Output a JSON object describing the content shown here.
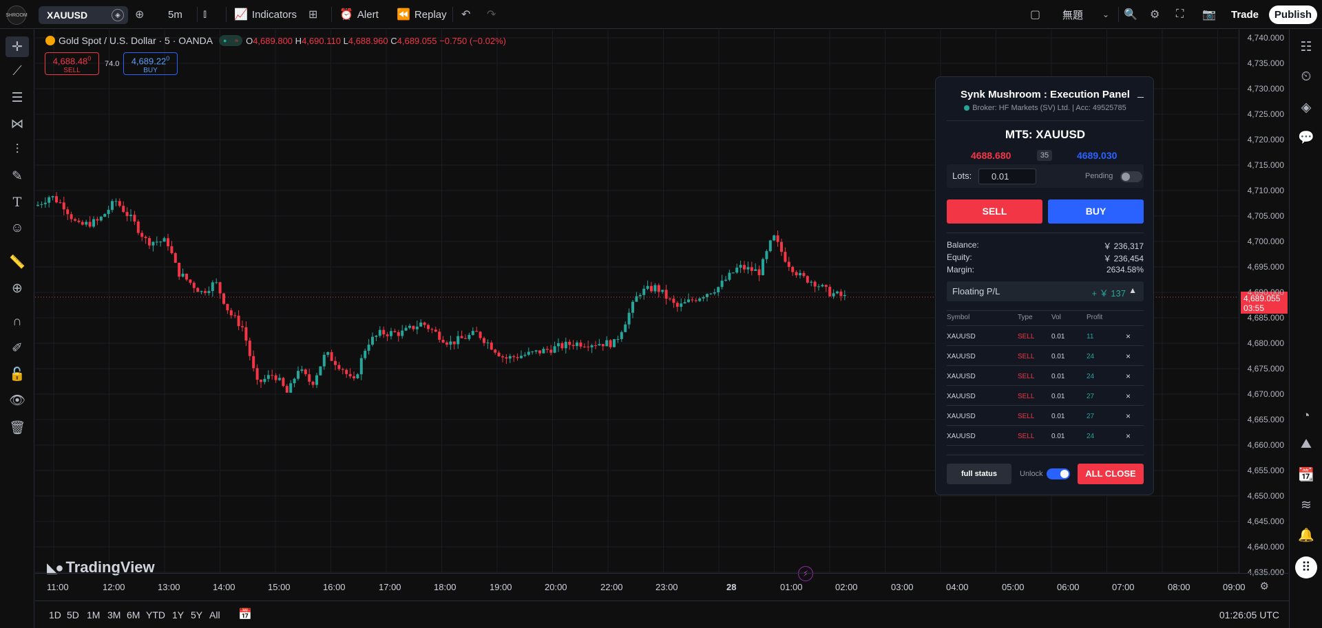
{
  "topbar": {
    "logo_text": "SHROOM",
    "symbol": "XAUUSD",
    "interval": "5m",
    "indicators_label": "Indicators",
    "alert_label": "Alert",
    "replay_label": "Replay",
    "layout_name": "無題",
    "trade_label": "Trade",
    "publish_label": "Publish"
  },
  "legend": {
    "title": "Gold Spot / U.S. Dollar · 5 · OANDA",
    "o_label": "O",
    "o_val": "4,689.800",
    "h_label": "H",
    "h_val": "4,690.110",
    "l_label": "L",
    "l_val": "4,688.960",
    "c_label": "C",
    "c_val": "4,689.055",
    "change": "−0.750 (−0.02%)"
  },
  "quick_trade": {
    "sell_price": "4,688.48",
    "sell_sup": "0",
    "sell_label": "SELL",
    "spread": "74.0",
    "buy_price": "4,689.22",
    "buy_sup": "0",
    "buy_label": "BUY"
  },
  "price_axis": {
    "labels": [
      "4,740.000",
      "4,735.000",
      "4,730.000",
      "4,725.000",
      "4,720.000",
      "4,715.000",
      "4,710.000",
      "4,705.000",
      "4,700.000",
      "4,695.000",
      "4,690.000",
      "4,685.000",
      "4,680.000",
      "4,675.000",
      "4,670.000",
      "4,665.000",
      "4,660.000",
      "4,655.000",
      "4,650.000",
      "4,645.000",
      "4,640.000",
      "4,635.000"
    ],
    "last_price": "4,689.055",
    "countdown": "03:55"
  },
  "time_axis": {
    "labels": [
      "11:00",
      "12:00",
      "13:00",
      "14:00",
      "15:00",
      "16:00",
      "17:00",
      "18:00",
      "19:00",
      "20:00",
      "22:00",
      "23:00",
      "28",
      "01:00",
      "02:00",
      "03:00",
      "04:00",
      "05:00",
      "06:00",
      "07:00",
      "08:00",
      "09:00"
    ]
  },
  "bottom": {
    "ranges": [
      "1D",
      "5D",
      "1M",
      "3M",
      "6M",
      "YTD",
      "1Y",
      "5Y",
      "All"
    ],
    "clock": "01:26:05 UTC"
  },
  "watermark": "TradingView",
  "panel": {
    "title": "Synk Mushroom : Execution Panel",
    "broker": "Broker: HF Markets (SV) Ltd.  | Acc: 49525785",
    "minimize": "_",
    "symbol_title": "MT5: XAUUSD",
    "bid": "4688.680",
    "spread": "35",
    "ask": "4689.030",
    "lots_label": "Lots:",
    "lots_value": "0.01",
    "pending_label": "Pending",
    "sell_label": "SELL",
    "buy_label": "BUY",
    "balance_label": "Balance:",
    "balance_value": "￥ 236,317",
    "equity_label": "Equity:",
    "equity_value": "￥ 236,454",
    "margin_label": "Margin:",
    "margin_value": "2634.58%",
    "floating_label": "Floating P/L",
    "floating_value": "+ ￥ 137",
    "floating_toggle": "▲",
    "table_headers": [
      "Symbol",
      "Type",
      "Vol",
      "Profit"
    ],
    "positions": [
      {
        "symbol": "XAUUSD",
        "type": "SELL",
        "vol": "0.01",
        "profit": "11"
      },
      {
        "symbol": "XAUUSD",
        "type": "SELL",
        "vol": "0.01",
        "profit": "24"
      },
      {
        "symbol": "XAUUSD",
        "type": "SELL",
        "vol": "0.01",
        "profit": "24"
      },
      {
        "symbol": "XAUUSD",
        "type": "SELL",
        "vol": "0.01",
        "profit": "27"
      },
      {
        "symbol": "XAUUSD",
        "type": "SELL",
        "vol": "0.01",
        "profit": "27"
      },
      {
        "symbol": "XAUUSD",
        "type": "SELL",
        "vol": "0.01",
        "profit": "24"
      }
    ],
    "close_glyph": "×",
    "full_status_label": "full status",
    "unlock_label": "Unlock",
    "all_close_label": "ALL CLOSE"
  },
  "colors": {
    "up": "#26a69a",
    "down": "#f23645",
    "accent": "#2962ff"
  }
}
